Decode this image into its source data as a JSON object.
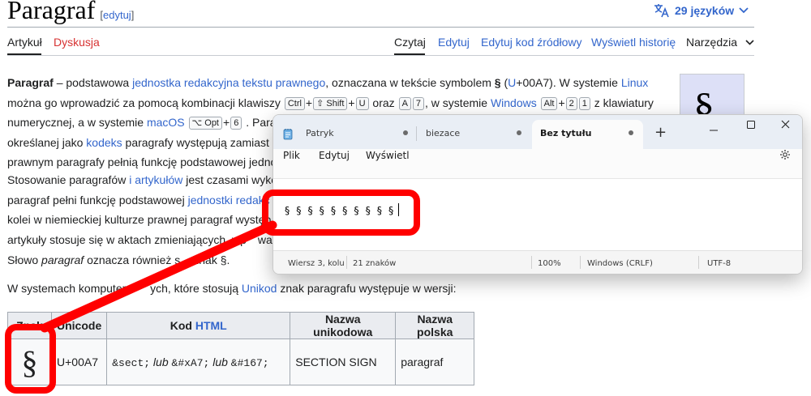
{
  "wiki": {
    "title": "Paragraf",
    "edit_link_open": "[",
    "edit_link": "edytuj",
    "edit_link_close": "]",
    "languages": "29 języków",
    "tabs_left": [
      "Artykuł",
      "Dyskusja"
    ],
    "tabs_right": [
      "Czytaj",
      "Edytuj",
      "Edytuj kod źródłowy",
      "Wyświetl historię",
      "Narzędzia"
    ]
  },
  "article": {
    "p1": {
      "b1": "Paragraf",
      "t1": " – podstawowa ",
      "l1": "jednostka redakcyjna tekstu prawnego",
      "t2": ", oznaczana w tekście symbolem ",
      "b2": "§",
      "t3": " (",
      "l2": "U",
      "t4": "+00A7). W systemie ",
      "l3": "Linux",
      "t5": " można go wprowadzić za pomocą kombinacji klawiszy ",
      "k1": "Ctrl",
      "plus": "+",
      "k2": "⇧ Shift",
      "k3": "U",
      "t6": " oraz ",
      "k4": "A",
      "k5": "7",
      "t7": ", w systemie ",
      "l4": "Windows",
      "k6": "Alt",
      "k7": "2",
      "k8": "1",
      "t8": " z klawiatury numerycznej, a w systemie ",
      "l5": "macOS",
      "k9": "⌥ Opt",
      "k10": "6",
      "t9": " . Paragrafy można dzi",
      "t10": "określanej jako ",
      "l6": "kodeks",
      "t11": " paragrafy występują zamiast u",
      "t12": "prawnym paragrafy pełnią funkcję podstawowej jednos"
    },
    "p2": {
      "t1": "Stosowanie paragrafów ",
      "l1": "i",
      "t2": " ",
      "l2": "artykułów",
      "t3": " jest czasami wykor",
      "t4": "paragraf pełni funkcję podstawowej ",
      "l3": "jednostki redakc",
      "t5": "kolei w niemieckiej kulturze prawnej paragraf występ",
      "t6": "artykuły stosuje się w aktach zmieniających, wp",
      "t7": "wadz"
    },
    "p3": {
      "t1": "Słowo ",
      "i1": "paragraf",
      "t2": " oznacza również s",
      "t3": "znak §."
    },
    "p4": {
      "t1": "W systemach komputero",
      "t2": "ych, które stosują ",
      "l1": "Unikod",
      "t3": " znak paragrafu występuje w wersji:"
    },
    "infobox_symbol": "§"
  },
  "table": {
    "headers": [
      "Znak",
      "Unicode",
      "Kod ",
      "HTML",
      "Nazwa unikodowa",
      "Nazwa polska"
    ],
    "row": {
      "znak": "§",
      "unicode": "U+00A7",
      "code1": "&sect;",
      "lub1": " lub ",
      "code2": "&#xA7;",
      "lub2": " lub ",
      "code3": "&#167;",
      "name_unicode": "SECTION SIGN",
      "name_pl": "paragraf"
    }
  },
  "notepad": {
    "tabs": [
      "Patryk",
      "biezace",
      "Bez tytułu"
    ],
    "new_tab": "+",
    "menu": [
      "Plik",
      "Edytuj",
      "Wyświetl"
    ],
    "content": "§ § § § § § § § § §",
    "status": {
      "position": "Wiersz 3, kolu",
      "chars": "21 znaków",
      "zoom": "100%",
      "line_endings": "Windows (CRLF)",
      "encoding": "UTF-8"
    }
  },
  "colors": {
    "annotation": "#ff0000",
    "link": "#3366cc",
    "red_link": "#d73333"
  }
}
